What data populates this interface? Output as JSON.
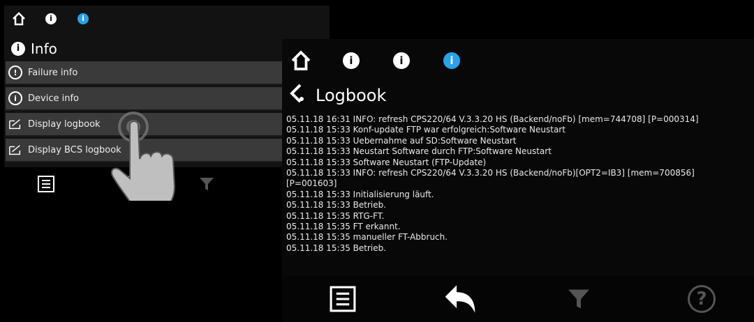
{
  "left_screen": {
    "title": "Info",
    "menu_items": [
      {
        "label": "Failure info",
        "icon": "exclamation-icon",
        "glyph": "!"
      },
      {
        "label": "Device info",
        "icon": "device-info-icon",
        "glyph": "i"
      },
      {
        "label": "Display logbook",
        "icon": "logbook-icon",
        "glyph": ""
      },
      {
        "label": "Display BCS logbook",
        "icon": "logbook-icon",
        "glyph": ""
      }
    ],
    "info_glyph": "i"
  },
  "right_screen": {
    "title": "Logbook",
    "info_glyph": "i",
    "log_lines": [
      "05.11.18 16:31 INFO: refresh CPS220/64 V.3.3.20 HS (Backend/noFb) [mem=744708] [P=000314]",
      "05.11.18 15:33 Konf-update FTP war erfolgreich:Software Neustart",
      "05.11.18 15:33 Uebernahme auf SD:Software Neustart",
      "05.11.18 15:33 Neustart Software durch FTP:Software Neustart",
      "05.11.18 15:33 Software Neustart (FTP-Update)",
      "05.11.18 15:33 INFO: refresh CPS220/64 V.3.3.20 HS (Backend/noFb)[OPT2=IB3] [mem=700856]",
      "[P=001603]",
      "05.11.18 15:33 Initialisierung läuft.",
      "05.11.18 15:33 Betrieb.",
      "05.11.18 15:35 RTG-FT.",
      "05.11.18 15:35 FT erkannt.",
      "05.11.18 15:35 manueller FT-Abbruch.",
      "05.11.18 15:35 Betrieb."
    ],
    "help_glyph": "?"
  },
  "colors": {
    "accent": "#2aa2e8",
    "menu_bg": "#3a3a3a"
  }
}
